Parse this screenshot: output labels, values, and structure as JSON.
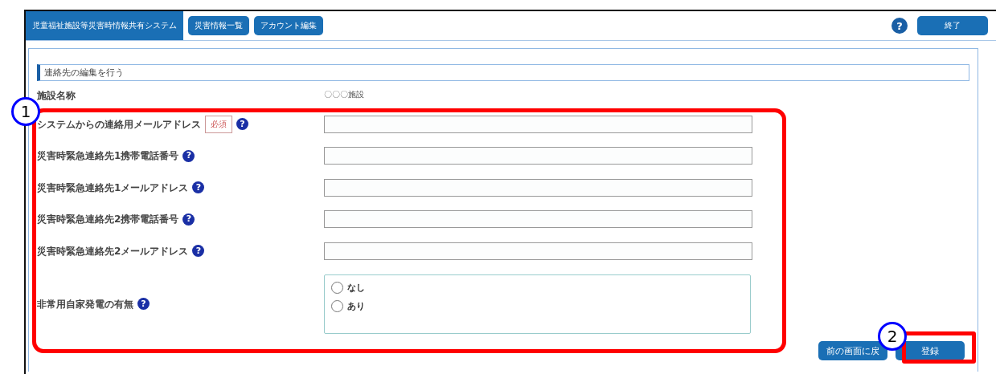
{
  "nav": {
    "tabs": [
      {
        "label": "児童福祉施設等災害時情報共有システム",
        "selected": true
      },
      {
        "label": "災害情報一覧",
        "selected": false
      },
      {
        "label": "アカウント編集",
        "selected": false
      }
    ],
    "help": "?",
    "exit": "終了"
  },
  "section_title": "連絡先の編集を行う",
  "facility": {
    "label": "施設名称",
    "value": "〇〇〇施設"
  },
  "fields": [
    {
      "label": "システムからの連絡用メールアドレス",
      "required": "必須",
      "help": "?",
      "kind": "text"
    },
    {
      "label": "災害時緊急連絡先1携帯電話番号",
      "help": "?",
      "kind": "text"
    },
    {
      "label": "災害時緊急連絡先1メールアドレス",
      "help": "?",
      "kind": "text"
    },
    {
      "label": "災害時緊急連絡先2携帯電話番号",
      "help": "?",
      "kind": "text"
    },
    {
      "label": "災害時緊急連絡先2メールアドレス",
      "help": "?",
      "kind": "text"
    },
    {
      "label": "非常用自家発電の有無",
      "help": "?",
      "kind": "radio",
      "options": [
        {
          "label": "なし",
          "selected": false
        },
        {
          "label": "あり",
          "selected": false
        }
      ]
    }
  ],
  "buttons": {
    "back": "前の画面に戻",
    "submit": "登録"
  },
  "annotations": [
    {
      "label": "1"
    },
    {
      "label": "2"
    }
  ]
}
